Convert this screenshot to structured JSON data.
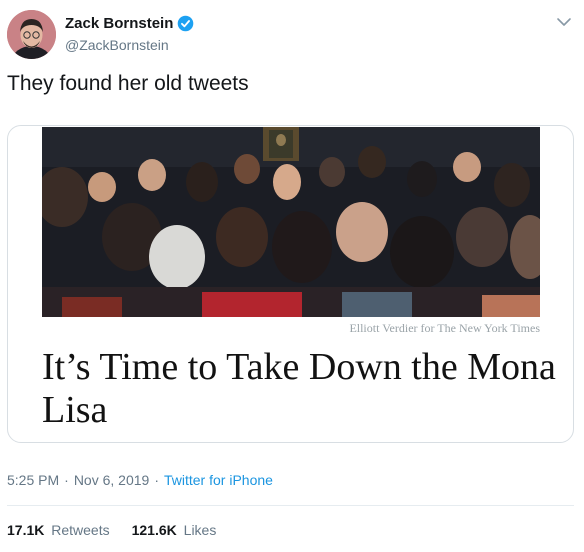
{
  "tweet": {
    "author": {
      "display_name": "Zack Bornstein",
      "handle": "@ZackBornstein",
      "verified": true
    },
    "text": "They found her old tweets",
    "card": {
      "photo_credit": "Elliott Verdier for The New York Times",
      "headline": "It’s Time to Take Down the Mona Lisa"
    },
    "meta": {
      "time": "5:25 PM",
      "separator": "·",
      "date": "Nov 6, 2019",
      "source": "Twitter for iPhone"
    },
    "stats": {
      "retweets_count": "17.1K",
      "retweets_label": "Retweets",
      "likes_count": "121.6K",
      "likes_label": "Likes"
    }
  },
  "colors": {
    "text": "#14171a",
    "secondary": "#657786",
    "link": "#1b95e0",
    "verified": "#1da1f2",
    "border": "#d8dee3"
  },
  "icons": [
    "verified-badge-icon",
    "chevron-down-icon"
  ]
}
